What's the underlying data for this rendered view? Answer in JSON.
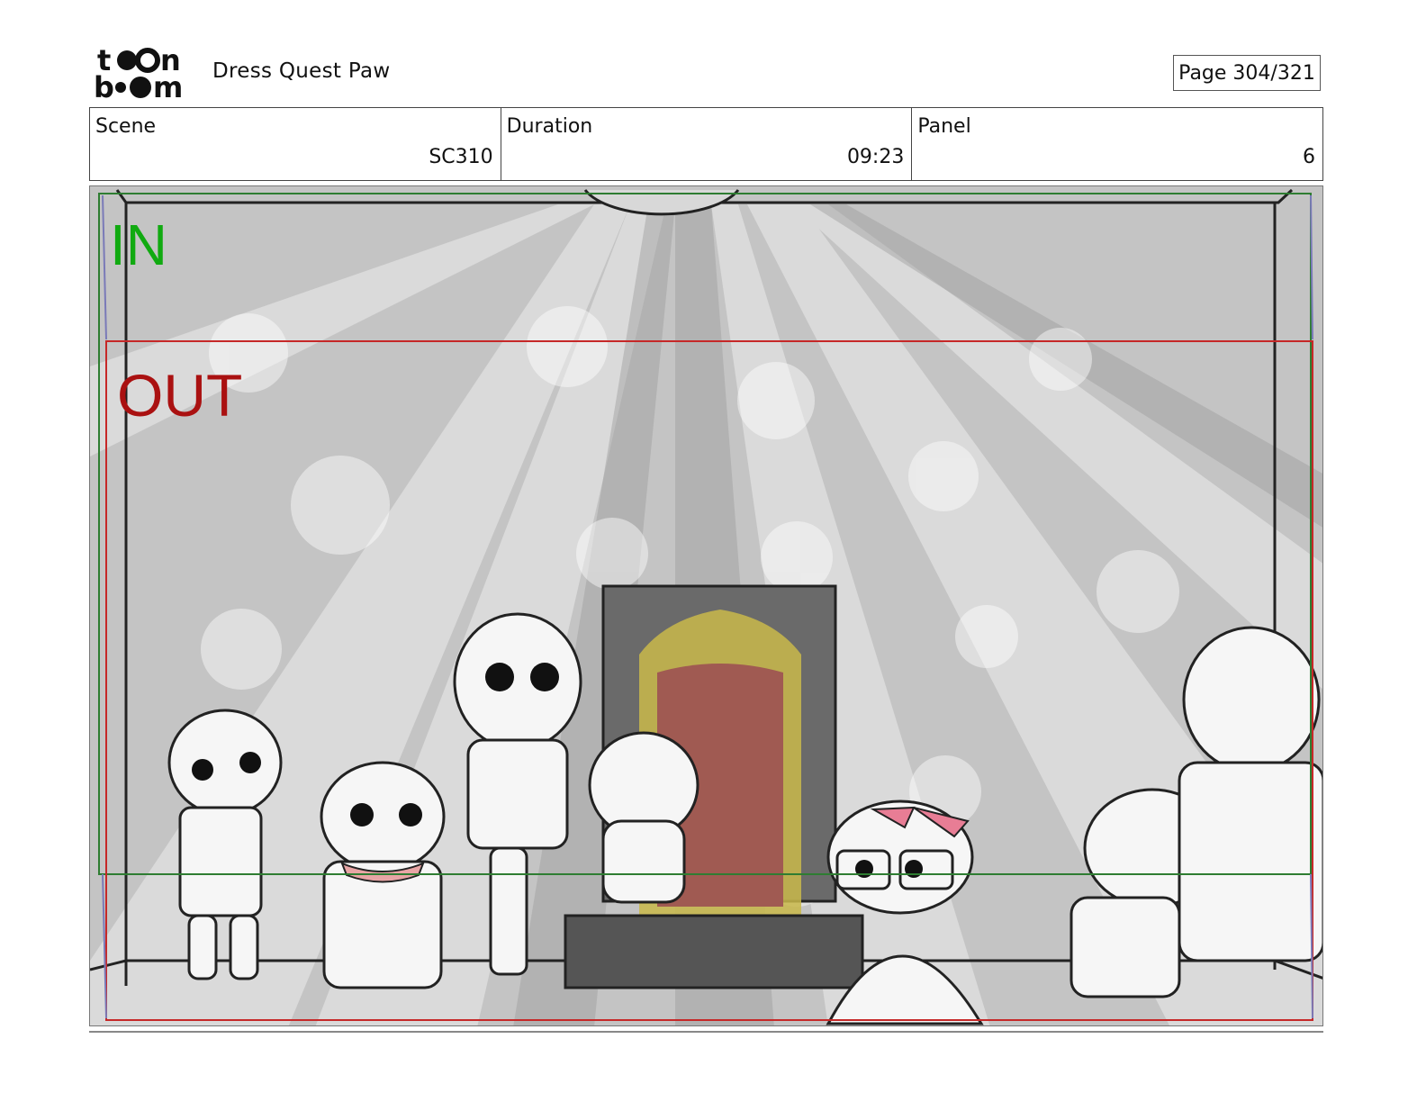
{
  "header": {
    "logo_text": "toon boom",
    "project_title": "Dress Quest Paw",
    "page_label": "Page 304/321"
  },
  "info": {
    "scene_label": "Scene",
    "scene_value": "SC310",
    "duration_label": "Duration",
    "duration_value": "09:23",
    "panel_label": "Panel",
    "panel_value": "6"
  },
  "panel": {
    "in_label": "IN",
    "out_label": "OUT",
    "colors": {
      "in_frame": "#2e7d32",
      "out_frame": "#c62828",
      "in_text": "#11aa11",
      "out_text": "#aa1111",
      "bow_pink": "#e87d95",
      "throne_gold": "#c9b94a",
      "throne_red": "#a05a52"
    }
  }
}
